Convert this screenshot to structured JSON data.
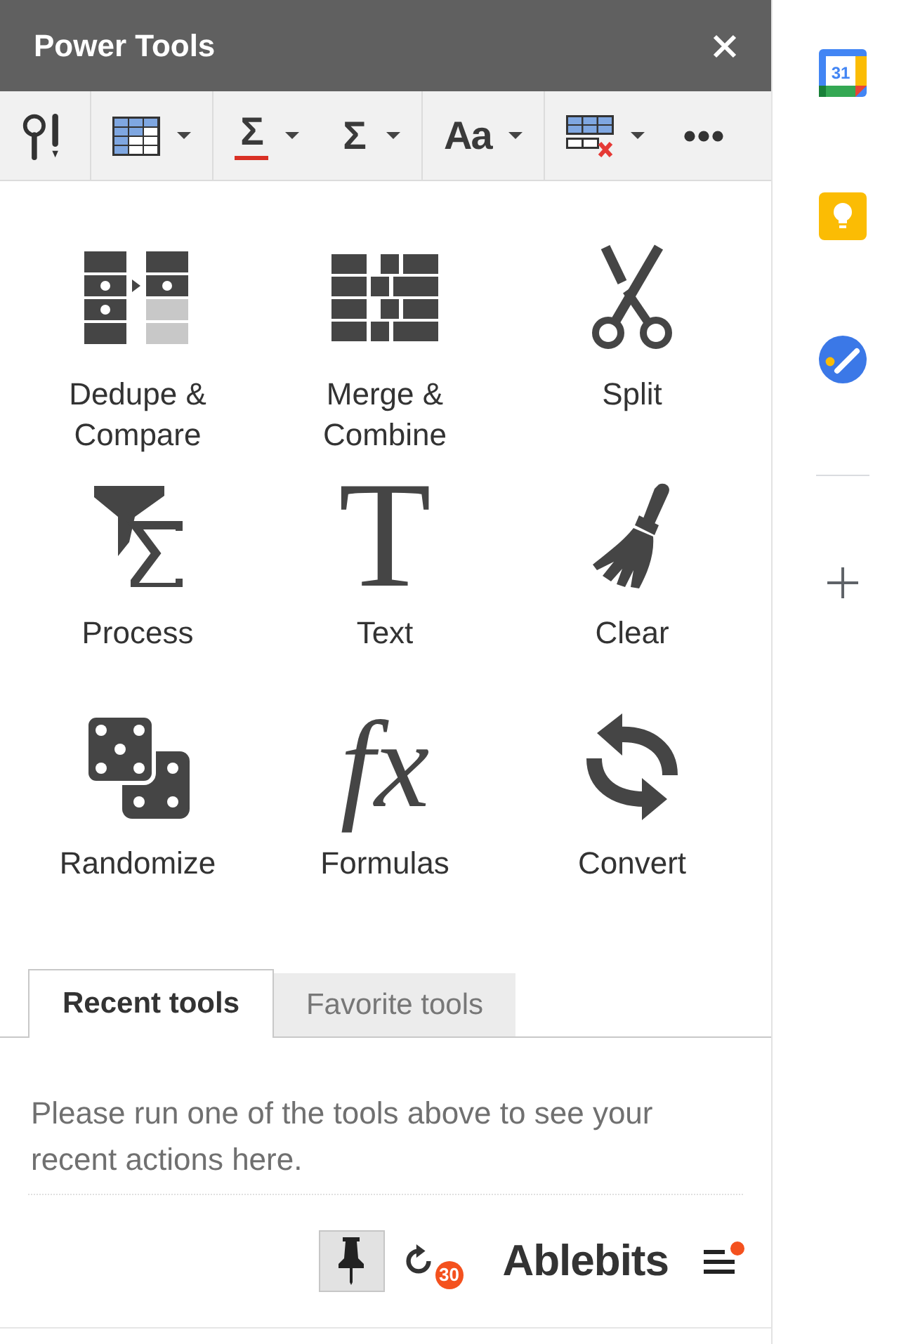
{
  "panel": {
    "title": "Power Tools"
  },
  "toolbar": {
    "groups": [
      {
        "items": [
          {
            "kind": "magnifier-alert",
            "dropdown": false
          }
        ]
      },
      {
        "items": [
          {
            "kind": "table",
            "dropdown": true
          }
        ]
      },
      {
        "items": [
          {
            "kind": "glyph",
            "glyph": "Σ",
            "underlined": true,
            "dropdown": true
          },
          {
            "kind": "glyph",
            "glyph": "Σ",
            "underlined": false,
            "dropdown": true
          }
        ]
      },
      {
        "items": [
          {
            "kind": "glyph",
            "glyph": "Aa",
            "underlined": false,
            "dropdown": true
          }
        ]
      },
      {
        "items": [
          {
            "kind": "table-delete",
            "dropdown": true
          },
          {
            "kind": "dots",
            "dropdown": false
          }
        ]
      }
    ]
  },
  "tools": [
    {
      "label": "Dedupe &\nCompare",
      "kind": "dedupe"
    },
    {
      "label": "Merge &\nCombine",
      "kind": "merge"
    },
    {
      "label": "Split",
      "kind": "scissors"
    },
    {
      "label": "Process",
      "kind": "funnel-sigma"
    },
    {
      "label": "Text",
      "kind": "letter",
      "glyph": "T"
    },
    {
      "label": "Clear",
      "kind": "broom"
    },
    {
      "label": "Randomize",
      "kind": "dice"
    },
    {
      "label": "Formulas",
      "kind": "math",
      "glyph": "fx"
    },
    {
      "label": "Convert",
      "kind": "arrows"
    }
  ],
  "tabs": [
    {
      "label": "Recent tools",
      "selected": true
    },
    {
      "label": "Favorite tools",
      "selected": false
    }
  ],
  "message": "Please run one of the tools above to see your recent actions here.",
  "footer": {
    "pinned": true,
    "count": "30",
    "brand": "Ablebits",
    "menu_unread": true
  },
  "side_panel": {
    "apps": [
      {
        "kind": "calendar",
        "glyph": "31"
      },
      {
        "kind": "lightbulb"
      },
      {
        "kind": "check-circle"
      }
    ]
  }
}
